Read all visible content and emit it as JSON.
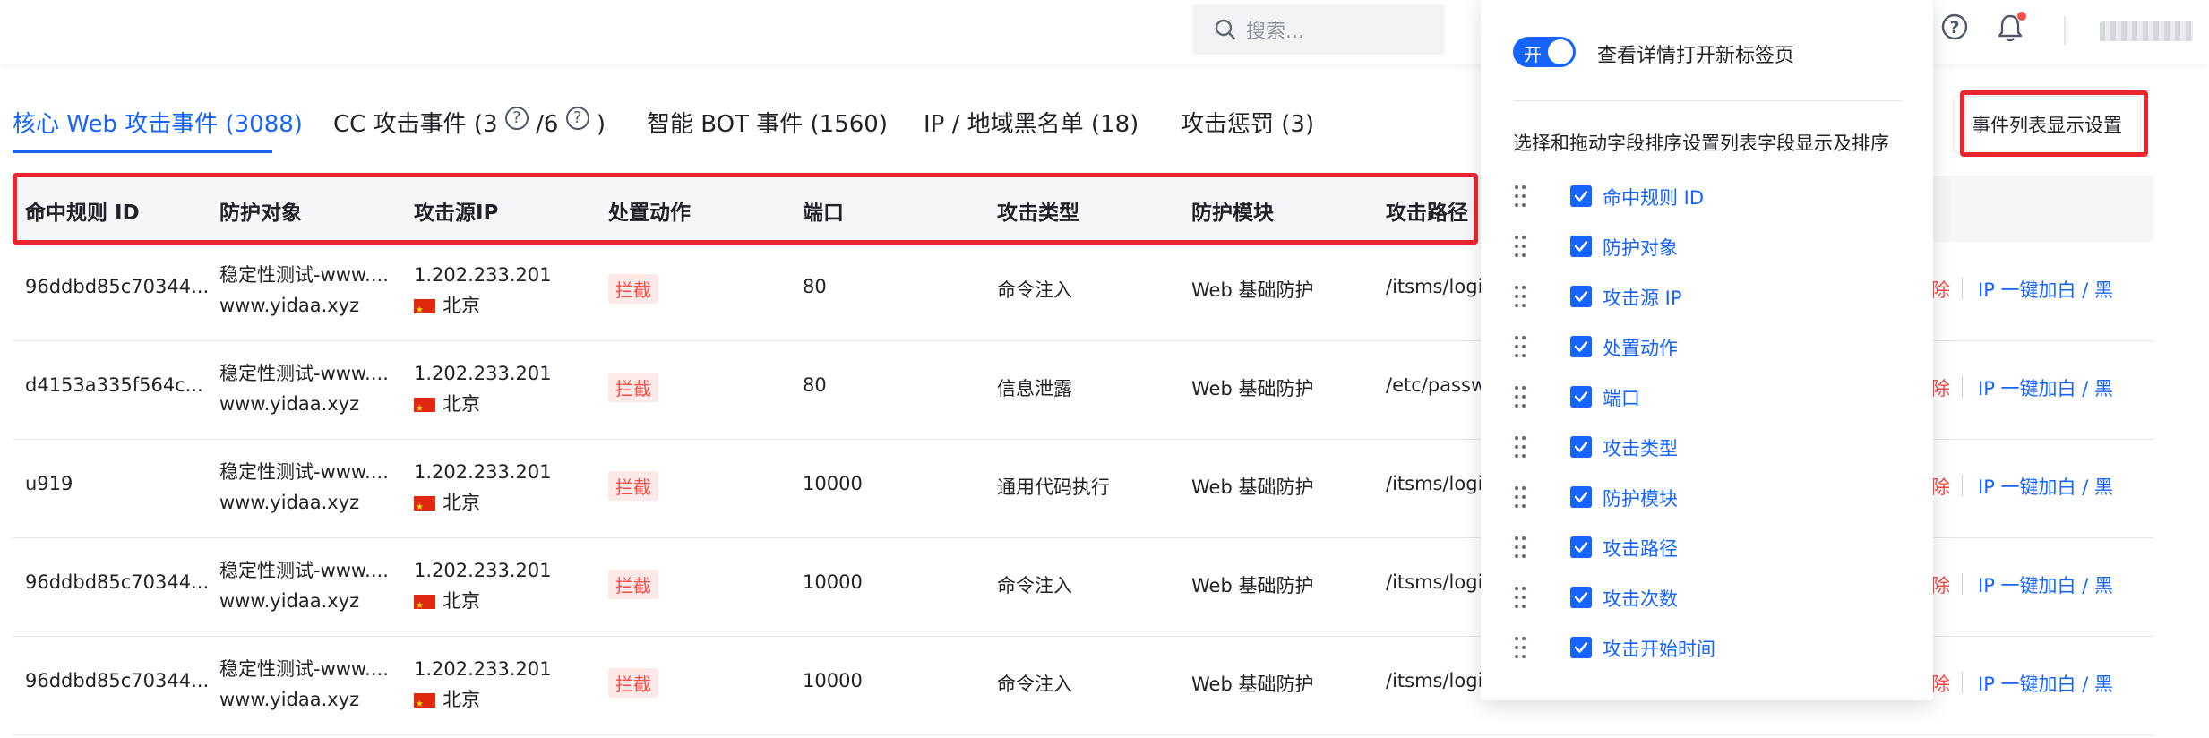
{
  "search": {
    "placeholder": "搜索..."
  },
  "tabs": [
    {
      "label": "核心 Web 攻击事件 (3088)",
      "active": true
    },
    {
      "label_prefix": "CC 攻击事件 (3",
      "label_mid": "/6",
      "label_suffix": ")",
      "help_glyph": "?"
    },
    {
      "label": "智能 BOT 事件 (1560)"
    },
    {
      "label": "IP / 地域黑名单 (18)"
    },
    {
      "label": "攻击惩罚 (3)"
    }
  ],
  "table": {
    "headers": [
      "命中规则 ID",
      "防护对象",
      "攻击源IP",
      "处置动作",
      "端口",
      "攻击类型",
      "防护模块",
      "攻击路径"
    ],
    "rows": [
      {
        "rule_id": "96ddbd85c70344...",
        "target_line1": "稳定性测试-www....",
        "target_line2": "www.yidaa.xyz",
        "ip": "1.202.233.201",
        "region": "北京",
        "action": "拦截",
        "port": "80",
        "attack_type": "命令注入",
        "module": "Web 基础防护",
        "path": "/itsms/login"
      },
      {
        "rule_id": "d4153a335f564c...",
        "target_line1": "稳定性测试-www....",
        "target_line2": "www.yidaa.xyz",
        "ip": "1.202.233.201",
        "region": "北京",
        "action": "拦截",
        "port": "80",
        "attack_type": "信息泄露",
        "module": "Web 基础防护",
        "path": "/etc/passwd"
      },
      {
        "rule_id": "u919",
        "target_line1": "稳定性测试-www....",
        "target_line2": "www.yidaa.xyz",
        "ip": "1.202.233.201",
        "region": "北京",
        "action": "拦截",
        "port": "10000",
        "attack_type": "通用代码执行",
        "module": "Web 基础防护",
        "path": "/itsms/login"
      },
      {
        "rule_id": "96ddbd85c70344...",
        "target_line1": "稳定性测试-www....",
        "target_line2": "www.yidaa.xyz",
        "ip": "1.202.233.201",
        "region": "北京",
        "action": "拦截",
        "port": "10000",
        "attack_type": "命令注入",
        "module": "Web 基础防护",
        "path": "/itsms/login"
      },
      {
        "rule_id": "96ddbd85c70344...",
        "target_line1": "稳定性测试-www....",
        "target_line2": "www.yidaa.xyz",
        "ip": "1.202.233.201",
        "region": "北京",
        "action": "拦截",
        "port": "10000",
        "attack_type": "命令注入",
        "module": "Web 基础防护",
        "path": "/itsms/login"
      }
    ],
    "row_ops": {
      "delete_partial": "除",
      "ip_action": "IP 一键加白 / 黑"
    }
  },
  "settings_button": {
    "label": "事件列表显示设置"
  },
  "panel": {
    "toggle_label": "开",
    "toggle_text": "查看详情打开新标签页",
    "hint": "选择和拖动字段排序设置列表字段显示及排序",
    "fields": [
      "命中规则 ID",
      "防护对象",
      "攻击源 IP",
      "处置动作",
      "端口",
      "攻击类型",
      "防护模块",
      "攻击路径",
      "攻击次数",
      "攻击开始时间"
    ]
  },
  "colors": {
    "accent": "#1664ff",
    "danger": "#f54a45",
    "highlight_box": "#e8262d"
  }
}
